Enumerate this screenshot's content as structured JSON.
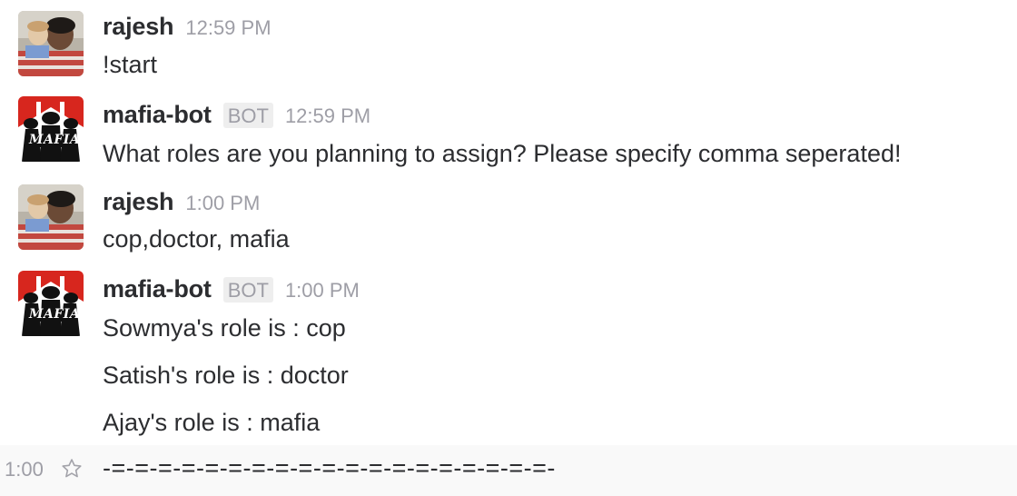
{
  "messages": [
    {
      "sender": "rajesh",
      "time": "12:59 PM",
      "text": "!start"
    },
    {
      "sender": "mafia-bot",
      "badge": "BOT",
      "time": "12:59 PM",
      "text": "What roles are you planning to assign? Please specify comma seperated!",
      "avatar_text": "MAFIA"
    },
    {
      "sender": "rajesh",
      "time": "1:00 PM",
      "text": "cop,doctor, mafia"
    },
    {
      "sender": "mafia-bot",
      "badge": "BOT",
      "time": "1:00 PM",
      "avatar_text": "MAFIA",
      "lines": [
        "Sowmya's role is : cop",
        "Satish's role is : doctor",
        "Ajay's role is : mafia"
      ]
    }
  ],
  "hover_message": {
    "time": "1:00",
    "icon": "star-icon",
    "text": "-=-=-=-=-=-=-=-=-=-=-=-=-=-=-=-=-=-=-=-"
  },
  "colors": {
    "text": "#2c2d30",
    "meta": "#9e9ea6",
    "badge_bg": "#eeeeee",
    "hover_bg": "#f9f9f9",
    "bot_red": "#d7261e"
  }
}
